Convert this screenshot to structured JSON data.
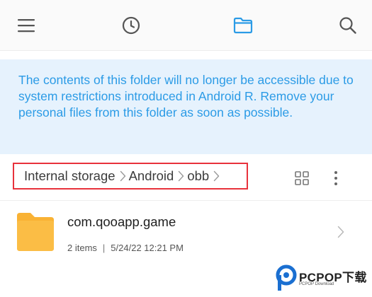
{
  "toolbar": {
    "menu_icon": "hamburger-icon",
    "recent_icon": "clock-icon",
    "files_icon": "folder-icon",
    "search_icon": "search-icon",
    "active_color": "#2b9be6"
  },
  "notice": {
    "text": "The contents of this folder will no longer be accessible due to system restrictions introduced in Android R. Remove your personal files from this folder as soon as possible.",
    "background": "#e6f2fd",
    "color": "#2b9be6"
  },
  "breadcrumb": {
    "items": [
      "Internal storage",
      "Android",
      "obb"
    ],
    "highlight_color": "#e8323c"
  },
  "files": [
    {
      "name": "com.qooapp.game",
      "items": "2 items",
      "date": "5/24/22 12:21 PM",
      "icon": "folder-icon",
      "icon_color": "#fbb838"
    }
  ],
  "watermark": {
    "main": "PCPOP下载",
    "sub": "PCPOP Download"
  }
}
